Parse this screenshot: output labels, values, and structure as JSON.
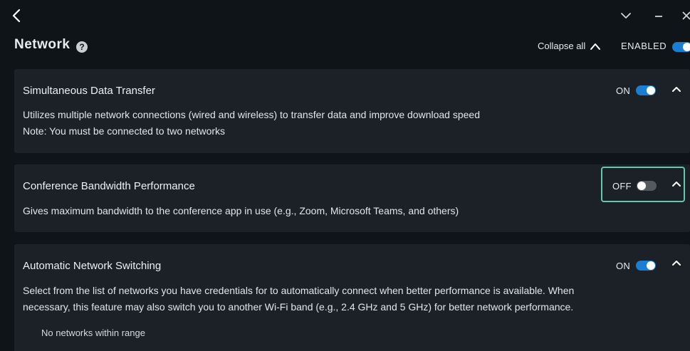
{
  "topbar": {
    "icons": {
      "back": "chevron-left-icon",
      "dropdown": "chevron-down-icon",
      "minimize": "minimize-icon",
      "close": "close-icon"
    }
  },
  "header": {
    "title": "Network",
    "help_icon": "?",
    "collapse_all_label": "Collapse all",
    "enabled_label": "ENABLED",
    "enabled_on": true
  },
  "cards": [
    {
      "title": "Simultaneous Data Transfer",
      "state_label": "ON",
      "on": true,
      "desc_lines": [
        "Utilizes multiple network connections (wired and wireless) to transfer data and improve download speed",
        "Note: You must be connected to two networks"
      ]
    },
    {
      "title": "Conference Bandwidth Performance",
      "state_label": "OFF",
      "on": false,
      "desc_lines": [
        "Gives maximum bandwidth to the conference app in use (e.g., Zoom, Microsoft Teams, and others)"
      ]
    },
    {
      "title": "Automatic Network Switching",
      "state_label": "ON",
      "on": true,
      "desc_lines": [
        "Select from the list of networks you have credentials for to automatically connect when better performance is available. When",
        "necessary, this feature may also switch you to another Wi-Fi band (e.g., 2.4 GHz and 5 GHz) for better network performance."
      ],
      "empty_note": "No networks within range"
    }
  ],
  "colors": {
    "accent": "#1a7ed3",
    "focus": "#63c7b2",
    "background": "#0f1418",
    "card": "#1b2126"
  }
}
